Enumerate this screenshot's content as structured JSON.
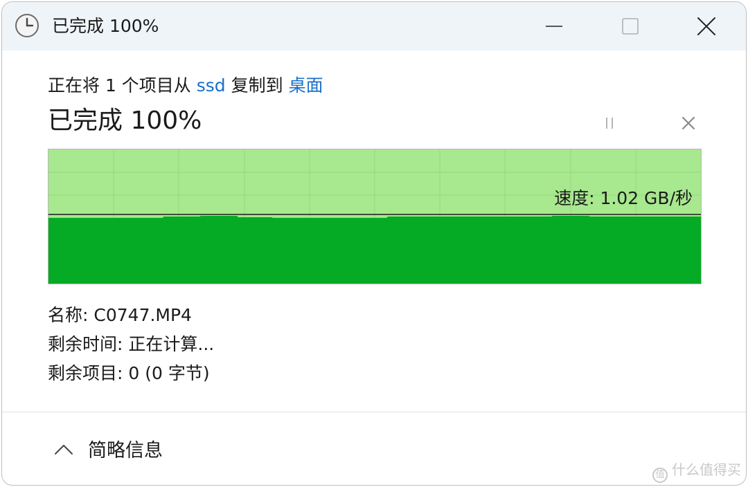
{
  "window": {
    "title": "已完成 100%",
    "icons": {
      "app": "clock-icon",
      "minimize": "minimize-icon",
      "maximize": "maximize-icon",
      "close": "close-icon"
    }
  },
  "copy": {
    "prefix": "正在将 1 个项目从 ",
    "source": "ssd",
    "middle": " 复制到 ",
    "destination": "桌面"
  },
  "status": {
    "text": "已完成 100%",
    "progress_percent": 100,
    "pause_icon": "pause-icon",
    "cancel_icon": "cancel-icon"
  },
  "graph": {
    "speed_label": "速度: 1.02 GB/秒",
    "fill_color": "#06ab25",
    "bg_color": "#a8e88f"
  },
  "details": {
    "name_label": "名称:",
    "name_value": "C0747.MP4",
    "time_label": "剩余时间:",
    "time_value": "正在计算...",
    "items_label": "剩余项目:",
    "items_value": "0 (0 字节)"
  },
  "footer": {
    "toggle_label": "简略信息",
    "toggle_icon": "chevron-up-icon"
  },
  "watermark": {
    "icon_text": "值",
    "text": "什么值得买"
  }
}
